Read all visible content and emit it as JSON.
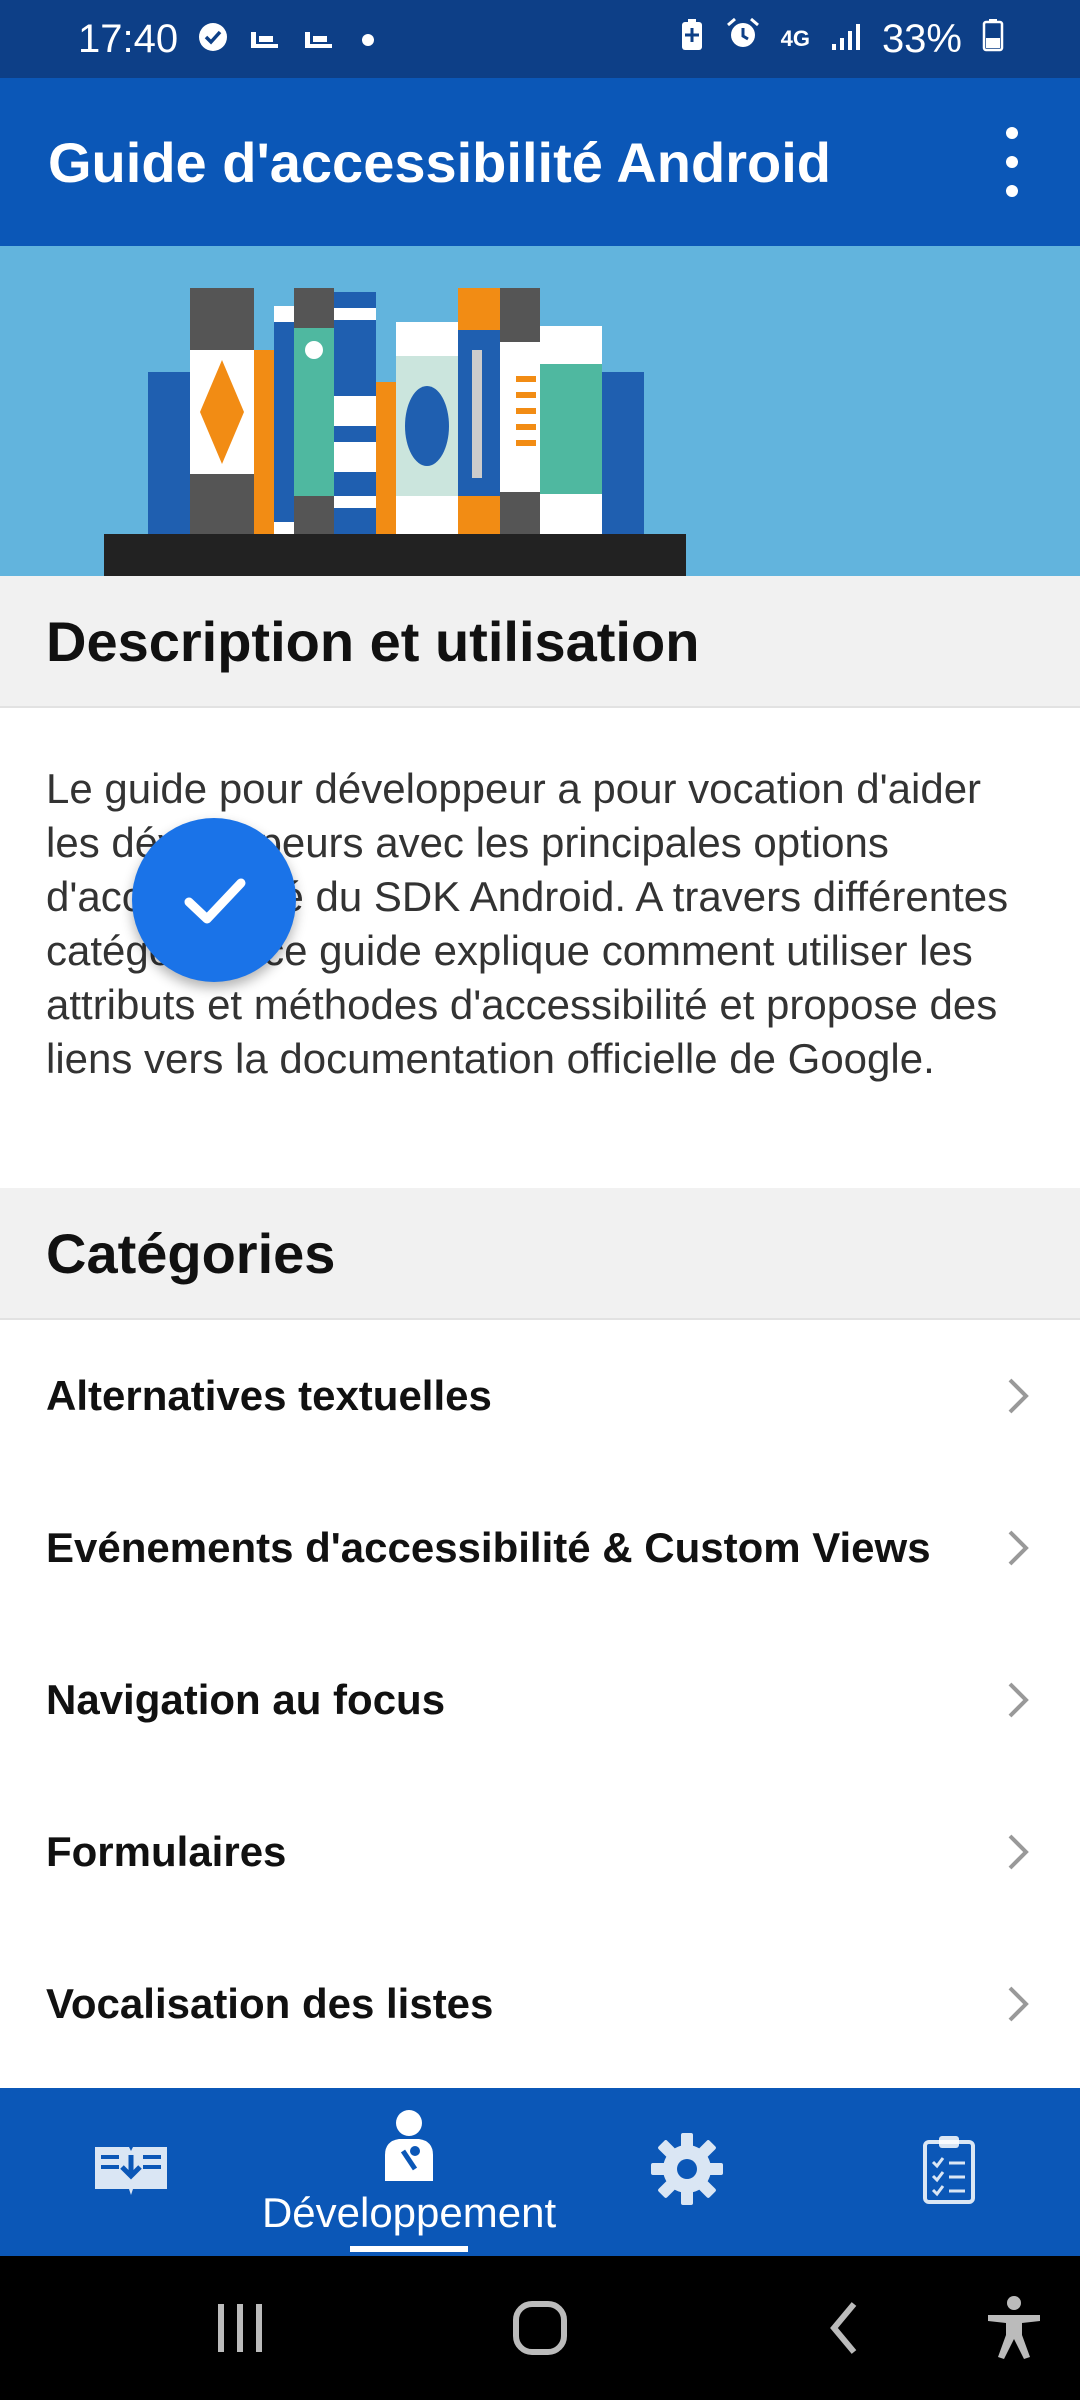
{
  "status_bar": {
    "time": "17:40",
    "network": "4G",
    "battery": "33%",
    "icons_left": [
      "check-circle-icon",
      "notification-icon",
      "notification-icon",
      "dot-icon"
    ],
    "icons_right": [
      "battery-saver-icon",
      "alarm-icon",
      "network-4g-icon",
      "signal-icon",
      "battery-icon"
    ]
  },
  "app_bar": {
    "title": "Guide d'accessibilité Android",
    "menu_icon": "more-vert-icon"
  },
  "hero": {
    "image": "books-illustration"
  },
  "description": {
    "heading": "Description et utilisation",
    "text": "Le guide pour développeur a pour vocation d'aider les développeurs avec les principales options d'accessibilité du SDK Android. A travers différentes catégories, ce guide explique comment utiliser les attributs et méthodes d'accessibilité et propose des liens vers la documentation officielle de Google."
  },
  "categories": {
    "heading": "Catégories",
    "items": [
      {
        "label": "Alternatives textuelles"
      },
      {
        "label": "Evénements d'accessibilité & Custom Views"
      },
      {
        "label": "Navigation au focus"
      },
      {
        "label": "Formulaires"
      },
      {
        "label": "Vocalisation des listes"
      }
    ]
  },
  "fab": {
    "icon": "check-icon"
  },
  "bottom_nav": {
    "items": [
      {
        "icon": "book-download-icon",
        "label": ""
      },
      {
        "icon": "developer-icon",
        "label": "Développement",
        "selected": true
      },
      {
        "icon": "settings-icon",
        "label": ""
      },
      {
        "icon": "clipboard-icon",
        "label": ""
      }
    ]
  },
  "system_nav": {
    "buttons": [
      "recents-icon",
      "home-icon",
      "back-icon",
      "accessibility-icon"
    ]
  },
  "colors": {
    "primary": "#0b57b7",
    "status_bar": "#0d3f87",
    "hero_bg": "#62b4dd",
    "fab": "#1a73e8"
  }
}
